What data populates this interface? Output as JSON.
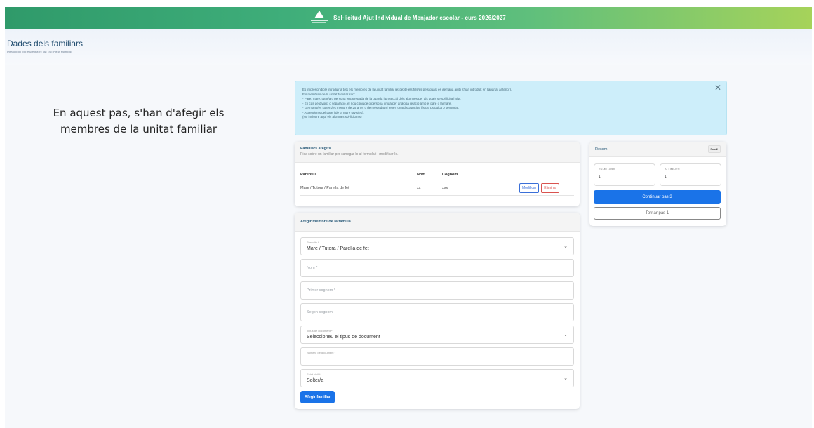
{
  "header": {
    "title": "Sol·licitud Ajut Individual de Menjador escolar - curs 2026/2027"
  },
  "page": {
    "title": "Dades dels familiars",
    "subtitle": "Introduïu els membres de la unitat familiar"
  },
  "caption": "En aquest pas, s'han d'afegir els membres de la unitat familiar",
  "alert": {
    "lines": [
      "És imprescindible introduir a tots els membres de la unitat familiar (excepte els fills/es pels quals es demana ajut i s'han introduït en l'apartat anterior).",
      "Els membres de la unitat familiar són:",
      "- Pare, mare, tutor/a o persona encarregada de la guarda i protecció dels alumnes per als quals se sol·licita l'ajut.",
      "- En cas de divorci o separació, el nou cònjuge o persona unida per anàloga relació amb el pare o la mare.",
      "- Germans/es solters/es menors de 25 anys o de més edat si tenen una discapacitat física, psíquica o sensorial.",
      "- Ascendents del pare i de la mare (avis/es).",
      "(No incloure aquí els alumnes sol·licitants)"
    ]
  },
  "familiars": {
    "title": "Familiars afegits",
    "subtitle": "Pica sobre un familiar per carregar-lo al formulari i modificar-lo.",
    "columns": [
      "Parentiu",
      "Nom",
      "Cognom"
    ],
    "rows": [
      {
        "parentiu": "Mare / Tutora / Parella de fet",
        "nom": "xx",
        "cognom": "xxx"
      }
    ],
    "modify_label": "Modificar",
    "delete_label": "Eliminar"
  },
  "form": {
    "title": "Afegir membre de la família",
    "parentiu_label": "Parentiu *",
    "parentiu_value": "Mare / Tutora / Parella de fet",
    "nom_placeholder": "Nom *",
    "cognom1_placeholder": "Primer cognom *",
    "cognom2_placeholder": "Segon cognom",
    "tipus_doc_label": "Tipus de document *",
    "tipus_doc_value": "Seleccioneu el tipus de document",
    "num_doc_placeholder": "Número de document *",
    "estat_label": "Estat civil *",
    "estat_value": "Solter/a",
    "submit_label": "Afegir familiar"
  },
  "summary": {
    "title": "Resum",
    "step": "Pas 2",
    "familiars_label": "FAMILIARS",
    "familiars_value": "1",
    "alumnes_label": "ALUMNES",
    "alumnes_value": "1",
    "continue_label": "Continuar pas 3",
    "back_label": "Tornar pas 1"
  },
  "colors": {
    "banner_start": "#2f9a6a",
    "banner_end": "#a6d35a",
    "primary": "#1a73e8",
    "alert_bg": "#cdeefa"
  }
}
